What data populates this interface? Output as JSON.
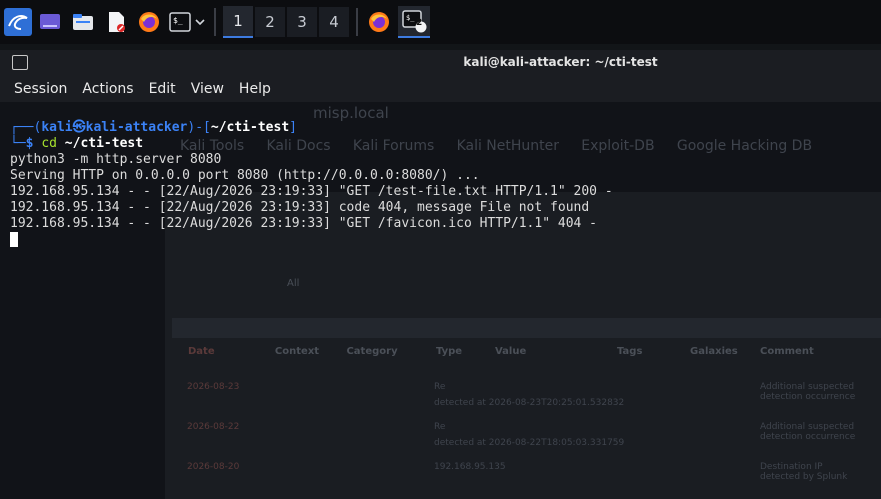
{
  "taskbar": {
    "workspaces": [
      "1",
      "2",
      "3",
      "4"
    ],
    "active_workspace": "1",
    "terminal_badge": "2",
    "icons": [
      "kali-menu-icon",
      "desktop-icon",
      "file-manager-icon",
      "text-editor-icon",
      "firefox-icon",
      "terminal-icon",
      "chevron-down-icon",
      "firefox-icon",
      "terminal-icon"
    ]
  },
  "window": {
    "title": "kali@kali-attacker: ~/cti-test"
  },
  "menu": [
    "Session",
    "Actions",
    "Edit",
    "View",
    "Help"
  ],
  "terminal": {
    "prompt_user": "kali",
    "prompt_at": "㉿",
    "prompt_host": "kali-attacker",
    "prompt_dir": "~/cti-test",
    "command_cd": "cd",
    "command_arg": "~/cti-test",
    "cmd_line": "python3 -m http.server 8080",
    "output": [
      "Serving HTTP on 0.0.0.0 port 8080 (http://0.0.0.0:8080/) ...",
      "192.168.95.134 - - [22/Aug/2026 23:19:33] \"GET /test-file.txt HTTP/1.1\" 200 -",
      "192.168.95.134 - - [22/Aug/2026 23:19:33] code 404, message File not found",
      "192.168.95.134 - - [22/Aug/2026 23:19:33] \"GET /favicon.ico HTTP/1.1\" 404 -"
    ]
  },
  "background_ghost": {
    "url": "misp.local",
    "bookmarks": [
      "Kali Tools",
      "Kali Docs",
      "Kali Forums",
      "Kali NetHunter",
      "Exploit-DB",
      "Google Hacking DB"
    ],
    "table_headers": [
      "Date",
      "Context",
      "Category",
      "Type",
      "Value",
      "Tags",
      "Galaxies",
      "Comment"
    ],
    "rows": [
      {
        "date": "2026-08-23",
        "value": "Re",
        "note": "detected at 2026-08-23T20:25:01.532832",
        "comment": "Additional suspected detection occurrence"
      },
      {
        "date": "2026-08-22",
        "value": "Re",
        "note": "detected at 2026-08-22T18:05:03.331759",
        "comment": "Additional suspected detection occurrence"
      },
      {
        "date": "2026-08-20",
        "value": "192.168.95.135",
        "note": "",
        "comment": "Destination IP detected by Splunk"
      }
    ],
    "tab_labels": [
      "All"
    ]
  }
}
